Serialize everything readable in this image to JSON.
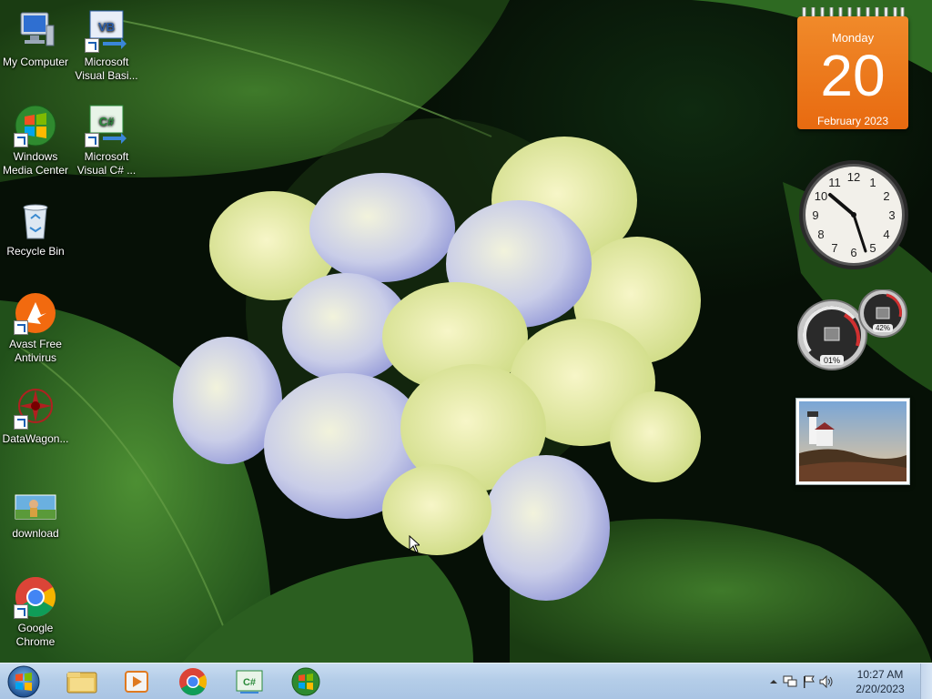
{
  "desktop": {
    "icons": [
      {
        "label": "My Computer",
        "icon": "computer-icon"
      },
      {
        "label": "Microsoft Visual Basi...",
        "icon": "visual-basic-icon",
        "badge": "VB"
      },
      {
        "label": "Windows Media Center",
        "icon": "media-center-icon"
      },
      {
        "label": "Microsoft Visual C# ...",
        "icon": "visual-csharp-icon",
        "badge": "C#"
      },
      {
        "label": "Recycle Bin",
        "icon": "recycle-bin-icon"
      },
      {
        "label": "Avast Free Antivirus",
        "icon": "avast-icon"
      },
      {
        "label": "DataWagon...",
        "icon": "datawagon-icon"
      },
      {
        "label": "download",
        "icon": "image-file-icon"
      },
      {
        "label": "Google Chrome",
        "icon": "chrome-icon"
      }
    ]
  },
  "gadgets": {
    "calendar": {
      "day": "Monday",
      "date": "20",
      "month": "February 2023"
    },
    "clock": {
      "numbers": [
        "12",
        "1",
        "2",
        "3",
        "4",
        "5",
        "6",
        "7",
        "8",
        "9",
        "10",
        "11"
      ]
    },
    "meter": {
      "cpu": "01%",
      "memory": "42%"
    },
    "slideshow": {
      "subject": "lighthouse-photo"
    }
  },
  "taskbar": {
    "pinned": [
      "windows-explorer-icon",
      "media-player-icon",
      "chrome-icon",
      "visual-csharp-icon",
      "media-center-icon"
    ],
    "csharp_badge": "C#",
    "tray": [
      "show-hidden-icons",
      "network-icon",
      "action-center-flag-icon",
      "volume-icon"
    ],
    "time": "10:27 AM",
    "date": "2/20/2023"
  },
  "colors": {
    "taskbar": "#b4cde8",
    "calendar": "#ec7a1c"
  }
}
